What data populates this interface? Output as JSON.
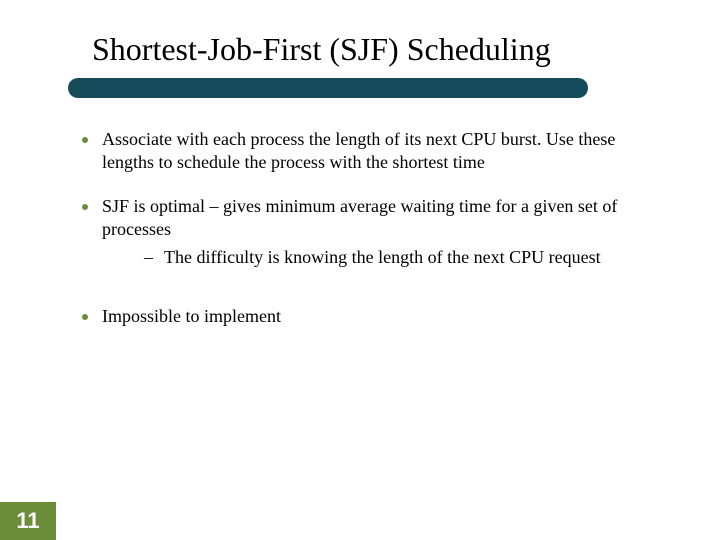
{
  "title": "Shortest-Job-First (SJF) Scheduling",
  "bullets": [
    {
      "text": "Associate with each process the length of its next CPU burst. Use these lengths to schedule the process with the shortest time",
      "sub": []
    },
    {
      "text": "SJF is optimal – gives minimum average waiting time for a given set of processes",
      "sub": [
        "The difficulty is knowing the length of the next CPU request"
      ]
    },
    {
      "text": "Impossible to implement",
      "sub": []
    }
  ],
  "page_number": "11",
  "colors": {
    "bar": "#154a5a",
    "accent": "#6b8d3a"
  }
}
